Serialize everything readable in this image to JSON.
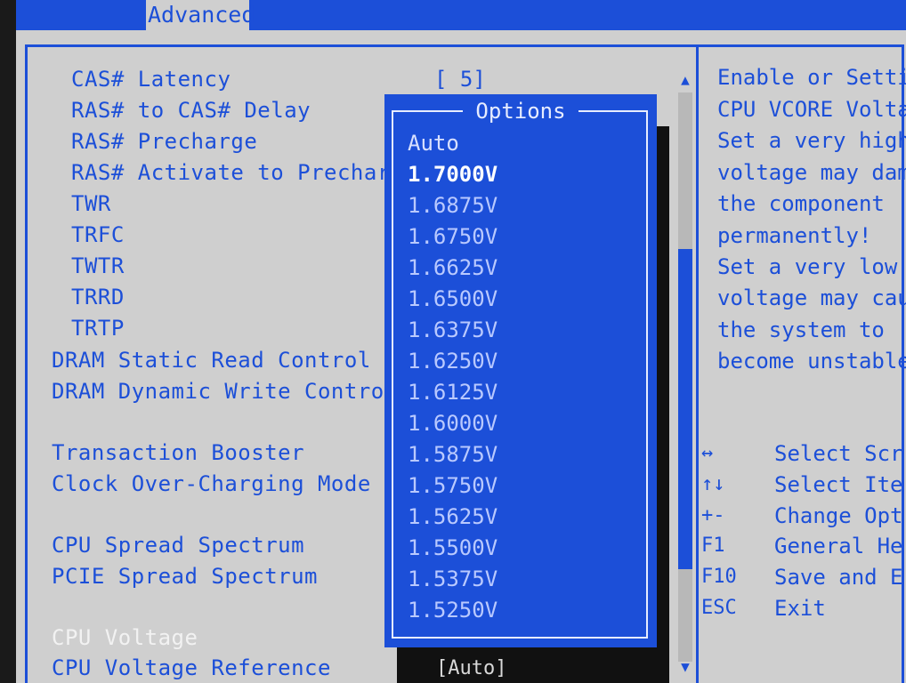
{
  "header": {
    "active_tab": "Advanced"
  },
  "settings": [
    {
      "label": "CAS# Latency"
    },
    {
      "label": "RAS# to CAS# Delay"
    },
    {
      "label": "RAS# Precharge"
    },
    {
      "label": "RAS# Activate to Precharg"
    },
    {
      "label": "TWR"
    },
    {
      "label": "TRFC"
    },
    {
      "label": "TWTR"
    },
    {
      "label": "TRRD"
    },
    {
      "label": "TRTP"
    },
    {
      "label": "DRAM Static Read Control"
    },
    {
      "label": "DRAM Dynamic Write Control"
    },
    {
      "label": "Transaction Booster"
    },
    {
      "label": "Clock Over-Charging Mode"
    },
    {
      "label": "CPU Spread Spectrum"
    },
    {
      "label": "PCIE Spread Spectrum"
    },
    {
      "label": "CPU Voltage"
    },
    {
      "label": "CPU Voltage Reference"
    }
  ],
  "values": {
    "cas_latency": "[ 5]",
    "cpu_voltage_reference": "[Auto]"
  },
  "popup": {
    "title": "Options",
    "options": [
      "Auto",
      "1.7000V",
      "1.6875V",
      "1.6750V",
      "1.6625V",
      "1.6500V",
      "1.6375V",
      "1.6250V",
      "1.6125V",
      "1.6000V",
      "1.5875V",
      "1.5750V",
      "1.5625V",
      "1.5500V",
      "1.5375V",
      "1.5250V"
    ],
    "selected": "1.7000V"
  },
  "help": {
    "lines": [
      "Enable or Setti",
      "CPU VCORE Volta",
      "Set a very high",
      "voltage may dam",
      "the component",
      "permanently!",
      "Set a very low",
      "voltage may cau",
      "the system to",
      "become unstable"
    ]
  },
  "keys": [
    {
      "key": "↔",
      "desc": "Select Scr"
    },
    {
      "key": "↑↓",
      "desc": "Select Ite"
    },
    {
      "key": "+-",
      "desc": "Change Opt"
    },
    {
      "key": "F1",
      "desc": "General He"
    },
    {
      "key": "F10",
      "desc": "Save and E"
    },
    {
      "key": "ESC",
      "desc": "Exit"
    }
  ],
  "scroll": {
    "up_icon": "▲",
    "down_icon": "▼"
  },
  "colors": {
    "bios_blue": "#1c4fd8",
    "background": "#cfcfcf"
  }
}
